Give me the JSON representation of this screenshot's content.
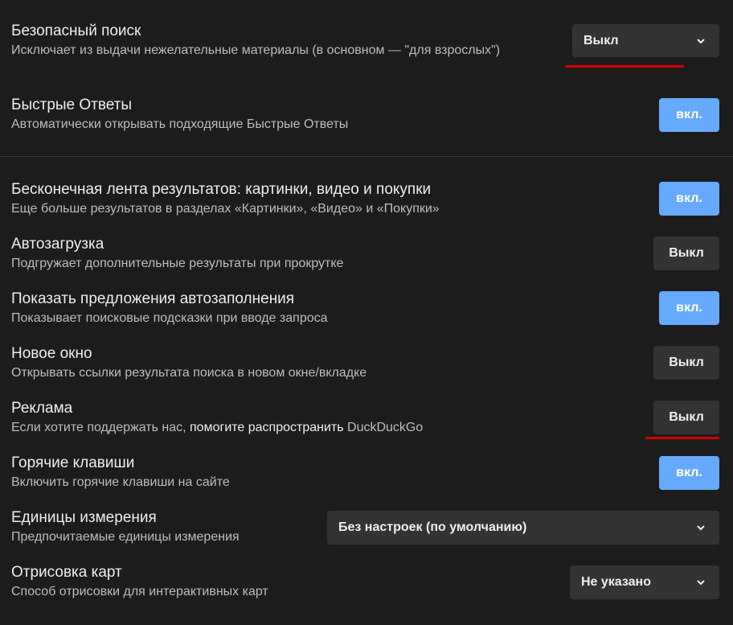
{
  "settings": {
    "safe_search": {
      "title": "Безопасный поиск",
      "desc": "Исключает из выдачи нежелательные материалы (в основном — \"для взрослых\")",
      "value": "Выкл"
    },
    "instant_answers": {
      "title": "Быстрые Ответы",
      "desc": "Автоматически открывать подходящие Быстрые Ответы",
      "button": "вкл."
    },
    "infinite_scroll": {
      "title": "Бесконечная лента результатов: картинки, видео и покупки",
      "desc": "Еще больше результатов в разделах «Картинки», «Видео» и «Покупки»",
      "button": "вкл."
    },
    "autoload": {
      "title": "Автозагрузка",
      "desc": "Подгружает дополнительные результаты при прокрутке",
      "button": "Выкл"
    },
    "autosuggest": {
      "title": "Показать предложения автозаполнения",
      "desc": "Показывает поисковые подсказки при вводе запроса",
      "button": "вкл."
    },
    "new_window": {
      "title": "Новое окно",
      "desc": "Открывать ссылки результата поиска в новом окне/вкладке",
      "button": "Выкл"
    },
    "ads": {
      "title": "Реклама",
      "desc_prefix": "Если хотите поддержать нас,",
      "desc_link": "помогите распространить",
      "desc_suffix": "DuckDuckGo",
      "button": "Выкл"
    },
    "hotkeys": {
      "title": "Горячие клавиши",
      "desc": "Включить горячие клавиши на сайте",
      "button": "вкл."
    },
    "units": {
      "title": "Единицы измерения",
      "desc": "Предпочитаемые единицы измерения",
      "value": "Без настроек (по умолчанию)"
    },
    "maps": {
      "title": "Отрисовка карт",
      "desc": "Способ отрисовки для интерактивных карт",
      "value": "Не указано"
    }
  },
  "colors": {
    "background": "#1c1c1c",
    "button_on": "#66aaff",
    "button_off": "#333333",
    "annotation": "#d50000"
  },
  "icons": {
    "dropdown": "chevron-down-icon"
  }
}
